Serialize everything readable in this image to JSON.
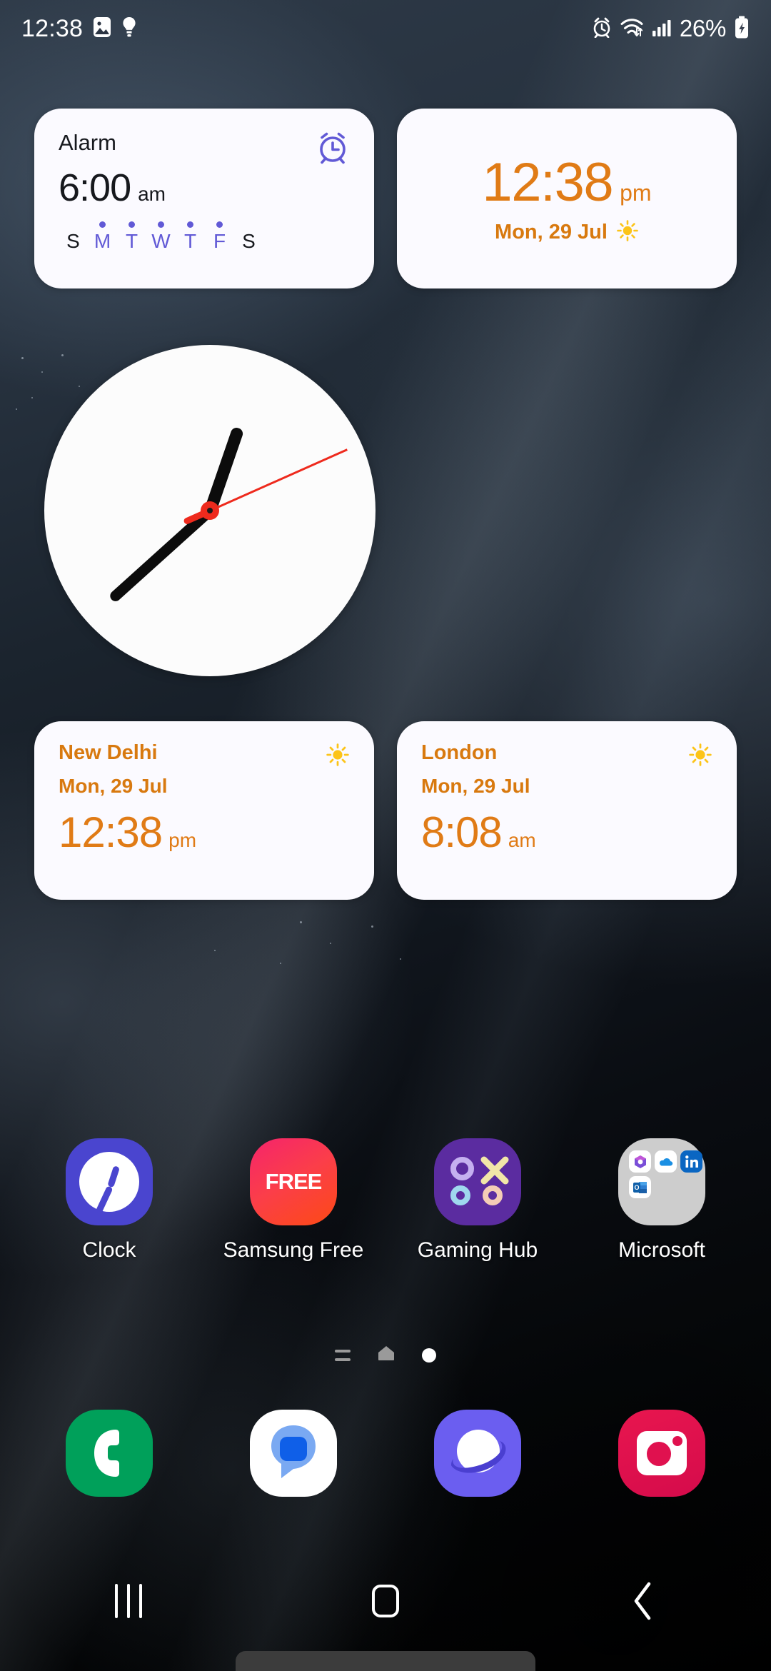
{
  "status_bar": {
    "time": "12:38",
    "left_icons": [
      "image-icon",
      "lightbulb-icon"
    ],
    "right_icons": [
      "alarm-icon",
      "wifi-icon",
      "signal-icon"
    ],
    "battery_percent": "26%",
    "battery_state": "charging"
  },
  "alarm_widget": {
    "title": "Alarm",
    "time": "6:00",
    "ampm": "am",
    "icon": "alarm-clock-icon",
    "accent_color": "#6159d6",
    "days": [
      {
        "letter": "S",
        "active": false
      },
      {
        "letter": "M",
        "active": true
      },
      {
        "letter": "T",
        "active": true
      },
      {
        "letter": "W",
        "active": true
      },
      {
        "letter": "T",
        "active": true
      },
      {
        "letter": "F",
        "active": true
      },
      {
        "letter": "S",
        "active": false
      }
    ]
  },
  "digital_clock_widget": {
    "time": "12:38",
    "ampm": "pm",
    "date": "Mon, 29 Jul",
    "weather_icon": "sun-icon",
    "accent_color": "#e07b16"
  },
  "analog_clock_widget": {
    "hour_angle": 379,
    "minute_angle": 228,
    "second_angle": 66,
    "face_color": "#fcfcfc",
    "second_hand_color": "#ee2a1d"
  },
  "world_clocks": [
    {
      "city": "New Delhi",
      "date": "Mon, 29 Jul",
      "time": "12:38",
      "ampm": "pm",
      "weather_icon": "sun-icon"
    },
    {
      "city": "London",
      "date": "Mon, 29 Jul",
      "time": "8:08",
      "ampm": "am",
      "weather_icon": "sun-icon"
    }
  ],
  "apps": [
    {
      "label": "Clock",
      "icon": "clock-app-icon"
    },
    {
      "label": "Samsung Free",
      "icon": "samsung-free-app-icon",
      "glyph": "FREE"
    },
    {
      "label": "Gaming Hub",
      "icon": "gaming-hub-app-icon"
    },
    {
      "label": "Microsoft",
      "icon": "microsoft-folder-icon",
      "folder_apps": [
        "microsoft-365-icon",
        "onedrive-icon",
        "linkedin-icon",
        "outlook-icon"
      ]
    }
  ],
  "page_indicator": {
    "items": [
      "feed-page-icon",
      "home-page-icon",
      "current-page-dot"
    ],
    "current": 2
  },
  "dock": [
    {
      "name": "Phone",
      "icon": "phone-icon"
    },
    {
      "name": "Messages",
      "icon": "messages-icon"
    },
    {
      "name": "Samsung Internet",
      "icon": "internet-icon"
    },
    {
      "name": "Camera",
      "icon": "camera-icon"
    }
  ],
  "nav_bar": {
    "recents": "recents-icon",
    "home": "home-icon",
    "back": "back-icon"
  }
}
